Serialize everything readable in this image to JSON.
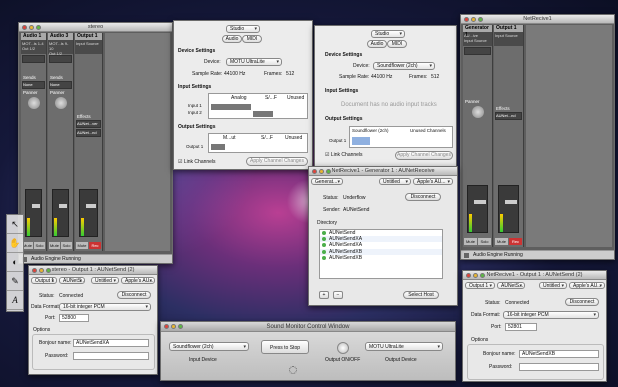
{
  "mixer_left": {
    "title": "stereo",
    "strips": [
      {
        "name": "Audio 1",
        "io": "MOT...ls 1-4",
        "out": "Out 1/2",
        "sends": "None",
        "btns": [
          "Mute",
          "Solo"
        ]
      },
      {
        "name": "Audio 3",
        "io": "MOT...ls 9-10",
        "out": "Out 1/2",
        "sends": "None",
        "btns": [
          "Mute",
          "Solo"
        ]
      },
      {
        "name": "Output 1",
        "io": "Input Source",
        "out": "MOTU U...traLite",
        "sends": "",
        "btns": [
          "Mute",
          "Rec"
        ]
      }
    ],
    "labels": {
      "sends": "Sends",
      "panner": "Panner",
      "effects": "Effects",
      "volume": "Volume",
      "meter": "Meter:"
    },
    "effects": [
      "AUNet...ver",
      "AUNet...nd"
    ],
    "status": "Audio Engine Running"
  },
  "studio1": {
    "seg": "Studio",
    "tabs": [
      "Audio",
      "MIDI"
    ],
    "device_settings": "Device Settings",
    "device_label": "Device:",
    "device": "MOTU UltraLite",
    "sample_rate_label": "Sample Rate:",
    "sample_rate": "44100 Hz",
    "frames_label": "Frames:",
    "frames": "512",
    "input_settings": "Input Settings",
    "input_cols": [
      "Analog",
      "S/...F",
      "Unused"
    ],
    "input_rows": [
      "Input 1",
      "Input 2"
    ],
    "output_settings": "Output Settings",
    "output_cols": [
      "M...ut",
      "S/...F",
      "Unused"
    ],
    "output_rows": [
      "Output 1"
    ],
    "link": "Link Channels",
    "apply": "Apply Channel Changes"
  },
  "studio2": {
    "seg": "Studio",
    "tabs": [
      "Audio",
      "MIDI"
    ],
    "device_settings": "Device Settings",
    "device_label": "Device:",
    "device": "Soundflower (2ch)",
    "sample_rate_label": "Sample Rate:",
    "sample_rate": "44100 Hz",
    "frames_label": "Frames:",
    "frames": "512",
    "input_settings": "Input Settings",
    "no_inputs": "Document has no audio input tracks",
    "output_settings": "Output Settings",
    "output_cols": [
      "Soundflower (2ch)",
      "Unused Channels"
    ],
    "output_rows": [
      "Output 1"
    ],
    "link": "Link Channels",
    "apply": "Apply Channel Changes"
  },
  "mixer_right": {
    "title": "NetRecive1",
    "strips": [
      {
        "name": "Generator 1",
        "io": "AU...ive",
        "out": "Input Source",
        "btns": [
          "Mute",
          "Solo"
        ]
      },
      {
        "name": "Output 1",
        "io": "Input Source",
        "out": "",
        "btns": [
          "Mute",
          "Rec"
        ]
      }
    ],
    "effects": [
      "AUNet...nd"
    ],
    "labels": {
      "effects": "Effects",
      "panner": "Panner",
      "volume": "Volume",
      "meter": "Meter:"
    },
    "status": "Audio Engine Running"
  },
  "net_receive": {
    "title": "NetRecive1 - Generator 1 : AUNetReceive",
    "toolbar": [
      "Generat...",
      "Untitled",
      "Apple's AU..."
    ],
    "status_label": "Status:",
    "status": "Underflow",
    "disconnect": "Disconnect",
    "sender_label": "Sender:",
    "sender": "AUNetSend",
    "directory": "Directory",
    "items": [
      "AUNetSend",
      "AUNetSendXA",
      "AUNetSendXA",
      "AUNetSendXB",
      "AUNetSendXB"
    ],
    "plus": "+",
    "minus": "−",
    "select_host": "Select Host"
  },
  "net_send_left": {
    "title": "stereo - Output 1 : AUNetSend (2)",
    "toolbar": [
      "Output 1",
      "AUNetS...",
      "Untitled",
      "Apple's AU..."
    ],
    "status_label": "Status:",
    "status": "Connected",
    "disconnect": "Disconnect",
    "format_label": "Data Format:",
    "format": "16-bit integer PCM",
    "port_label": "Port:",
    "port": "52800",
    "options": "Options",
    "bonjour_label": "Bonjour name:",
    "bonjour": "AUNetSendXA",
    "password_label": "Password:",
    "password": ""
  },
  "net_send_right": {
    "title": "NetRecive1 - Output 1 : AUNetSend (2)",
    "toolbar": [
      "Output 1",
      "AUNetS...",
      "Untitled",
      "Apple's AU..."
    ],
    "status_label": "Status:",
    "status": "Connected",
    "disconnect": "Disconnect",
    "format_label": "Data Format:",
    "format": "16-bit integer PCM",
    "port_label": "Port:",
    "port": "52801",
    "options": "Options",
    "bonjour_label": "Bonjour name:",
    "bonjour": "AUNetSendXB",
    "password_label": "Password:",
    "password": ""
  },
  "monitor": {
    "title": "Sound Monitor Control Window",
    "input_device": "Soundflower (2ch)",
    "input_label": "Input Device",
    "press": "Press to Stop",
    "output_toggle": "Output ON/OFF",
    "output_device": "MOTU UltraLite",
    "output_label": "Output Device"
  }
}
